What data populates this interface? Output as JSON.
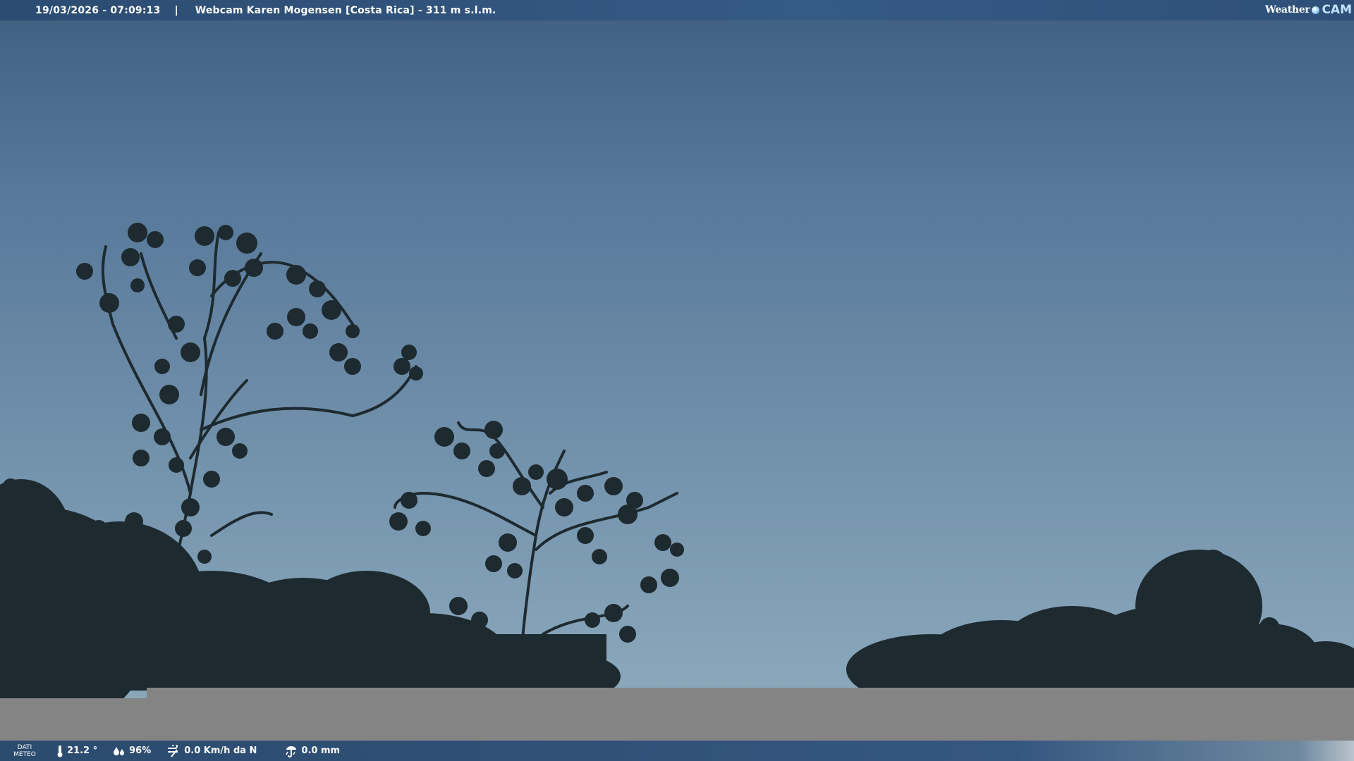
{
  "header": {
    "datetime": "19/03/2026 - 07:09:13",
    "separator": "|",
    "title": "Webcam Karen Mogensen [Costa Rica] - 311 m s.l.m."
  },
  "logo": {
    "weather_text": "Weather",
    "cam_text": "CAM"
  },
  "weather_bar": {
    "label_line1": "DATI",
    "label_line2": "METEO",
    "temperature": "21.2 °",
    "humidity": "96%",
    "wind": "0.0 Km/h da N",
    "rain": "0.0 mm"
  },
  "icons": {
    "temperature": "thermometer-icon",
    "humidity": "humidity-drops-icon",
    "wind": "wind-icon",
    "rain": "rain-gauge-icon"
  },
  "colors": {
    "sky_top": "#3f5f80",
    "sky_bottom": "#8aa7ba",
    "foliage": "#1d2b30",
    "bar": "#2c4c72",
    "band": "#848484"
  }
}
